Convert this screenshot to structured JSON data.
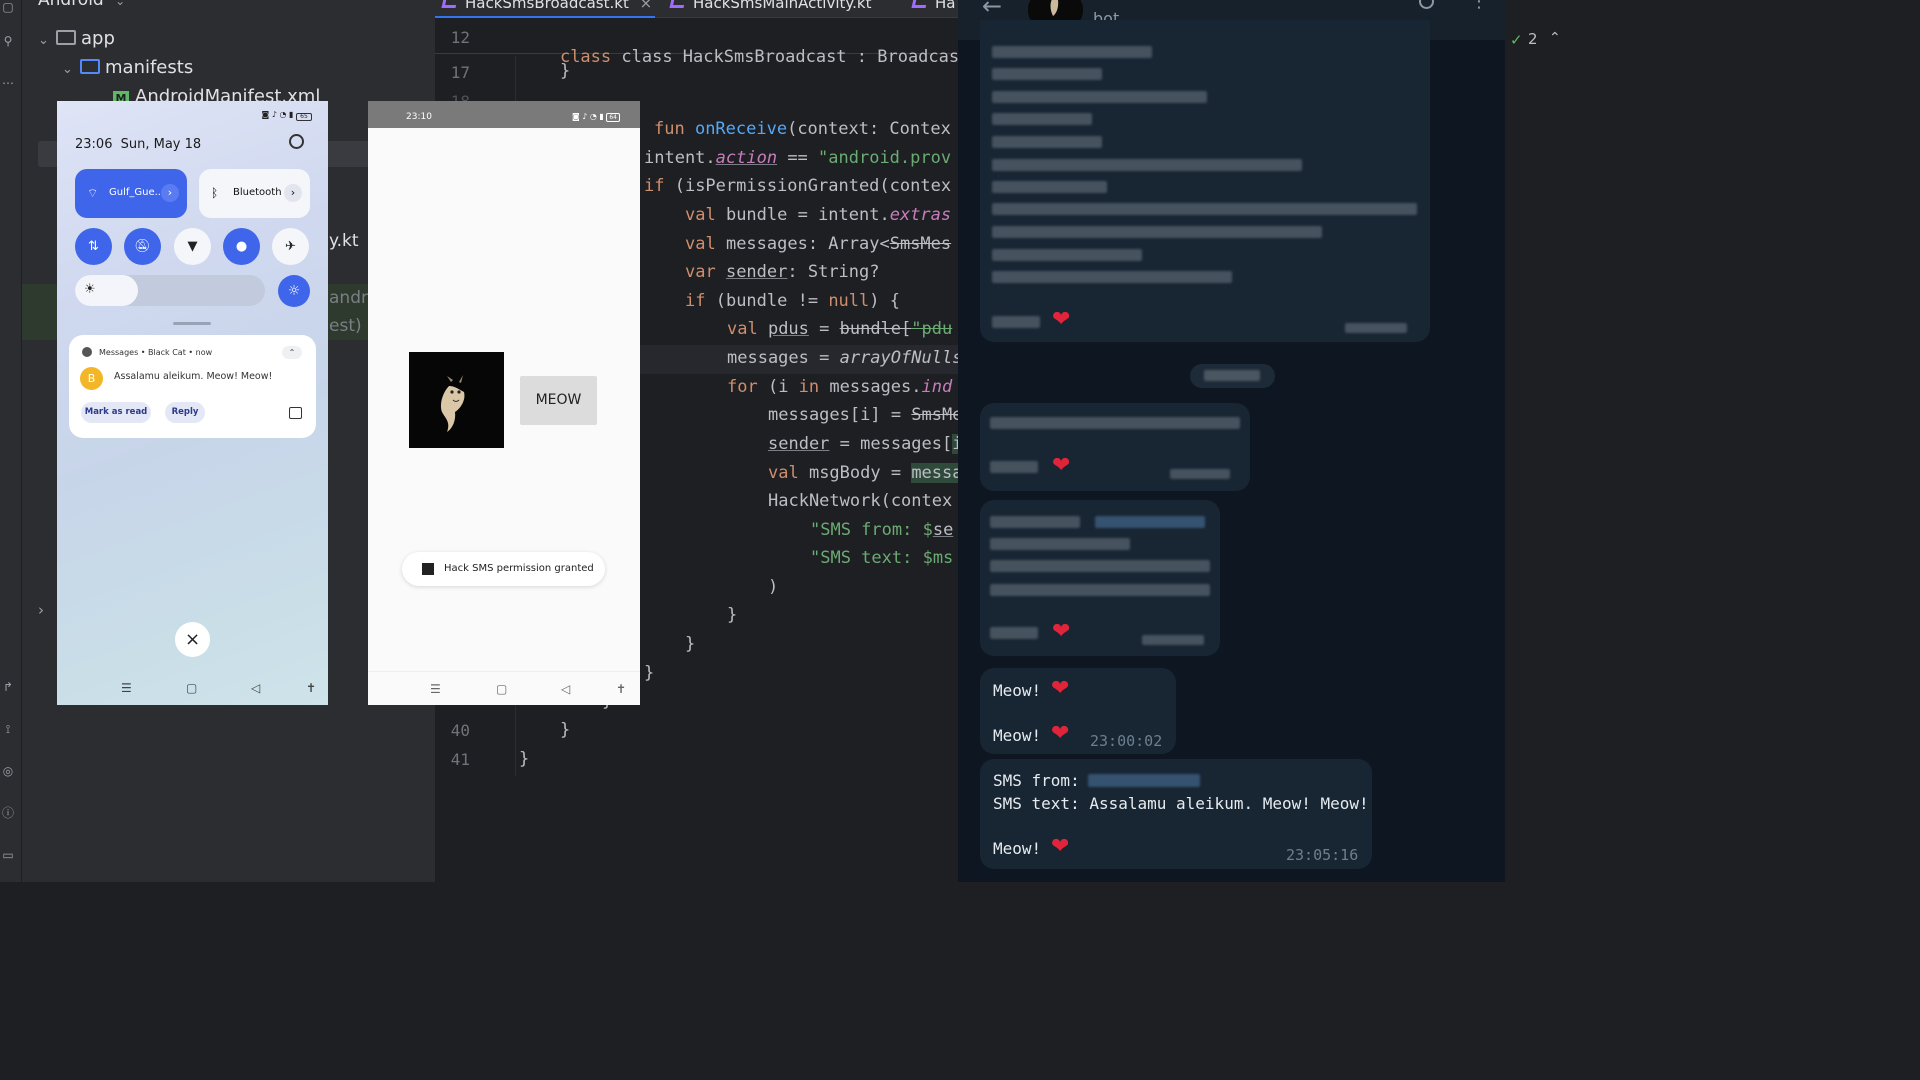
{
  "ide": {
    "project_view": "Android",
    "tree": {
      "app": "app",
      "manifests": "manifests",
      "manifest_file": "AndroidManifest.xml",
      "partial_kt": "y.kt",
      "partial_androi": "androi",
      "partial_est": "est)"
    },
    "tabs": [
      "HackSmsBroadcast.kt",
      "HackSmsMainActivity.kt",
      "Ha"
    ],
    "sticky": {
      "line": "12",
      "code": "class HackSmsBroadcast : BroadcastReceiver"
    },
    "line_numbers": {
      "l17": "17",
      "l18": "18",
      "l40": "40",
      "l41": "41"
    },
    "code_lines": {
      "c17": "}",
      "c_fun_kw": "fun ",
      "c_fun_name": "onReceive",
      "c_fun_rest": "(context: Contex",
      "c_intent_pre": "intent.",
      "c_intent_prop": "action",
      "c_intent_eq": " == ",
      "c_intent_str": "\"android.prov",
      "c_if_kw": "if ",
      "c_if_rest": "(isPermissionGranted(contex",
      "c_bundle_kw": "val ",
      "c_bundle_mid": "bundle = intent.",
      "c_bundle_prop": "extras",
      "c_msgs_kw": "val ",
      "c_msgs_rest": "messages: Array<",
      "c_msgs_strike": "SmsMes",
      "c_sender_kw": "var ",
      "c_sender_name": "sender",
      "c_sender_rest": ": String?",
      "c_ifb_kw": "if ",
      "c_ifb_pre": "(bundle != ",
      "c_ifb_null": "null",
      "c_ifb_end": ") {",
      "c_pdus_kw": "val ",
      "c_pdus_name": "pdus",
      "c_pdus_eq": " = ",
      "c_pdus_strike": "bundle[",
      "c_pdus_str": "\"pdu",
      "c_arr_pre": "messages = ",
      "c_arr_fn": "arrayOfNulls",
      "c_for_kw": "for ",
      "c_for_pre": "(i ",
      "c_for_in": "in",
      "c_for_mid": " messages.",
      "c_for_prop": "ind",
      "c_mi_pre": "messages[i] = ",
      "c_mi_strike": "SmsMe",
      "c_snd_name": "sender",
      "c_snd_rest": " = messages[",
      "c_snd_hl": "i",
      "c_body_kw": "val ",
      "c_body_rest": "msgBody = ",
      "c_body_hl": "messa",
      "c_net": "HackNetwork(contex",
      "c_from_str": "\"SMS from: $",
      "c_from_var": "se",
      "c_text_str": "\"SMS text: $ms",
      "c_paren": ")",
      "c_brace1": "}",
      "c_brace2": "}",
      "c_brace3": "}",
      "c_brace4": "}",
      "c_brace5": "}",
      "c_brace6": "}"
    },
    "inspection": {
      "count": "2"
    },
    "colors": {
      "keyword": "#cf8e6d",
      "function": "#56a8f5",
      "string": "#6aab73",
      "property": "#c77dbb"
    }
  },
  "phone1": {
    "time": "23:06",
    "date": "Sun, May 18",
    "battery": "65",
    "tiles": {
      "wifi": "Gulf_Gue..",
      "bluetooth": "Bluetooth"
    },
    "brightness_fraction": 0.33,
    "notification": {
      "header": "Messages • Black Cat • now",
      "avatar_letter": "B",
      "text": "Assalamu aleikum. Meow! Meow!",
      "mark_as_read": "Mark as read",
      "reply": "Reply"
    }
  },
  "phone2": {
    "time": "23:10",
    "battery": "64",
    "button": "MEOW",
    "toast": "Hack SMS permission granted"
  },
  "telegram": {
    "chat_name": "bot",
    "msg_meow1": "Meow!",
    "msg_meow2": "Meow!",
    "msg_time1": "23:00:02",
    "sms_from_label": "SMS from: ",
    "sms_text_line": "SMS text: Assalamu aleikum. Meow! Meow!",
    "msg_meow3": "Meow!",
    "msg_time2": "23:05:16",
    "accent": "#0e1621"
  }
}
